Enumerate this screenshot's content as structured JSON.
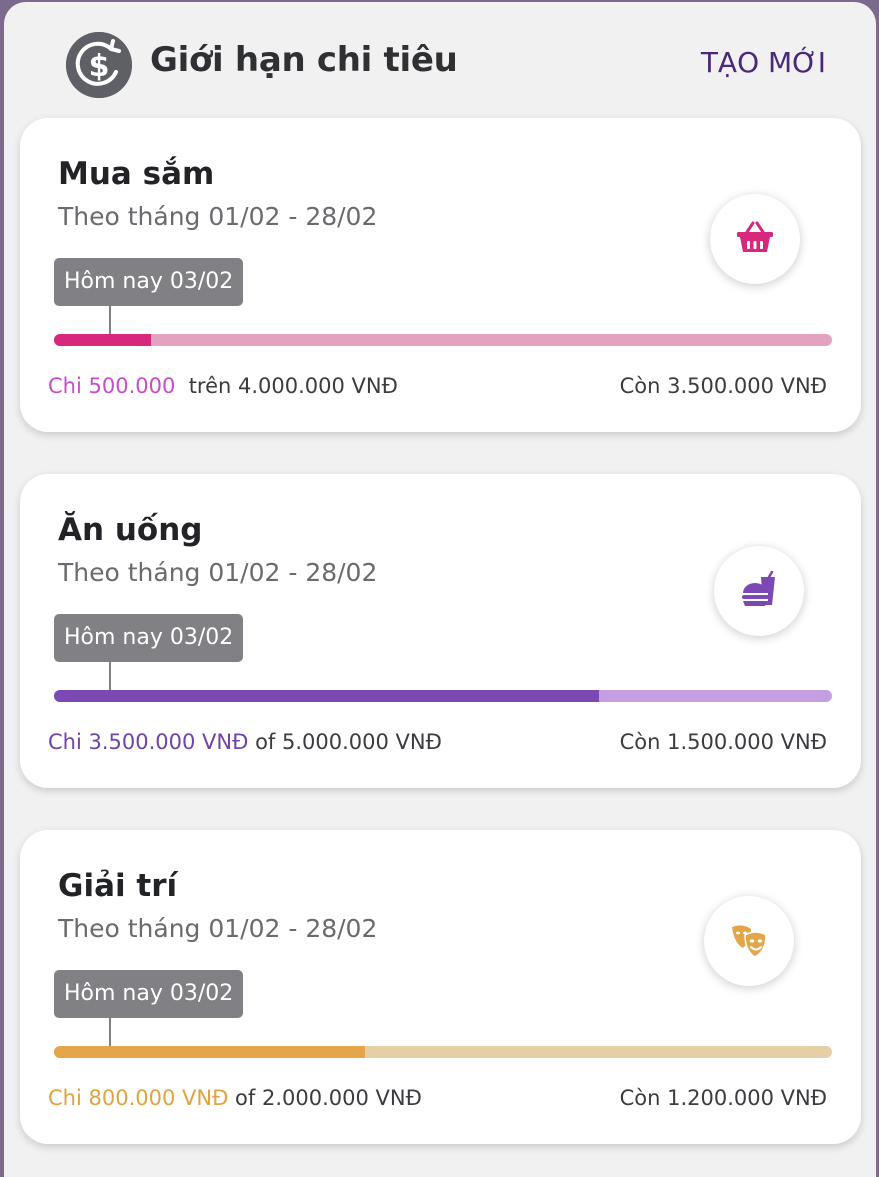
{
  "header": {
    "title": "Giới hạn chi tiêu",
    "create_label": "TẠO MỚI",
    "icon": "dollar-circle-icon"
  },
  "budgets": [
    {
      "name": "Mua sắm",
      "period": "Theo tháng 01/02 - 28/02",
      "today_label": "Hôm nay 03/02",
      "spent_text": "Chi 500.000",
      "of_text": "trên 4.000.000 VNĐ",
      "remaining_text": "Còn 3.500.000 VNĐ",
      "progress": 0.125,
      "today_progress": 0.071,
      "icon": "shopping-basket-icon",
      "color": "#d6287d",
      "track_color": "#e3a3c0",
      "spent_color": "#c54ec9"
    },
    {
      "name": "Ăn uống",
      "period": "Theo tháng 01/02 - 28/02",
      "today_label": "Hôm nay 03/02",
      "spent_text": "Chi 3.500.000 VNĐ",
      "of_text": "of 5.000.000 VNĐ",
      "remaining_text": "Còn 1.500.000 VNĐ",
      "progress": 0.7,
      "today_progress": 0.071,
      "icon": "burger-drink-icon",
      "color": "#7c48b4",
      "track_color": "#c39ee2",
      "spent_color": "#7043a8"
    },
    {
      "name": "Giải trí",
      "period": "Theo tháng 01/02 - 28/02",
      "today_label": "Hôm nay 03/02",
      "spent_text": "Chi 800.000 VNĐ",
      "of_text": "of 2.000.000 VNĐ",
      "remaining_text": "Còn 1.200.000 VNĐ",
      "progress": 0.4,
      "today_progress": 0.071,
      "icon": "theater-masks-icon",
      "color": "#e3a64b",
      "track_color": "#e7cfa5",
      "spent_color": "#e0a341"
    }
  ]
}
